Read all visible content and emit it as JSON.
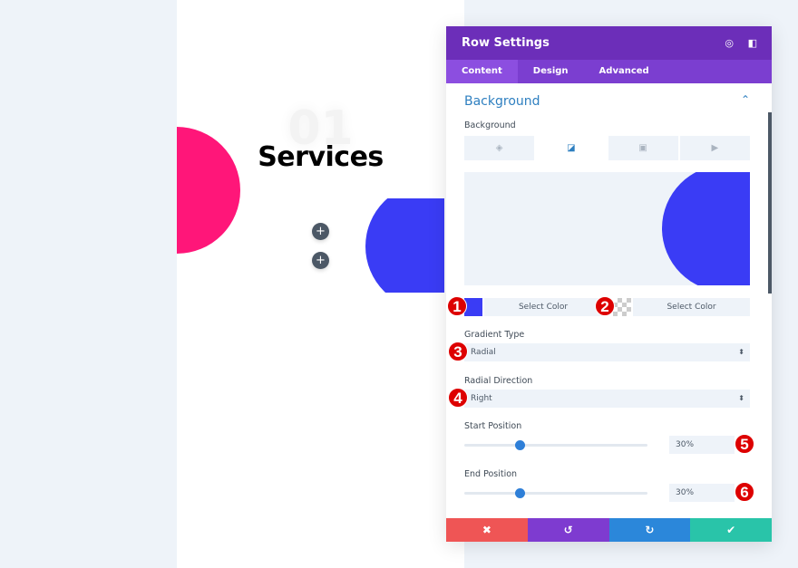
{
  "canvas": {
    "number": "01",
    "title": "Services",
    "add_buttons": [
      "+",
      "+"
    ],
    "colors": {
      "pink": "#ff1679",
      "blue": "#3a3cf5"
    }
  },
  "panel": {
    "title": "Row Settings",
    "header_icons": [
      "focus-icon",
      "sidebar-toggle-icon"
    ],
    "tabs": [
      {
        "label": "Content",
        "active": true
      },
      {
        "label": "Design"
      },
      {
        "label": "Advanced"
      }
    ],
    "section_title": "Background",
    "background_label": "Background",
    "background_types": [
      "color-icon",
      "gradient-icon",
      "image-icon",
      "video-icon"
    ],
    "active_background_type": "gradient",
    "gradient": {
      "color1": {
        "swatch": "#3a3cf5",
        "label": "Select Color",
        "badge": "1"
      },
      "color2": {
        "swatch": "transparent",
        "label": "Select Color",
        "badge": "2"
      },
      "gradient_type": {
        "label": "Gradient Type",
        "value": "Radial",
        "badge": "3"
      },
      "radial_direction": {
        "label": "Radial Direction",
        "value": "Right",
        "badge": "4"
      },
      "start_position": {
        "label": "Start Position",
        "value": "30%",
        "percent": 30,
        "badge": "5"
      },
      "end_position": {
        "label": "End Position",
        "value": "30%",
        "percent": 30,
        "badge": "6"
      }
    },
    "footer": {
      "cancel": "✖",
      "undo": "↺",
      "redo": "↻",
      "save": "✔",
      "colors": {
        "cancel": "#ef5555",
        "undo": "#7e3bd0",
        "redo": "#2b87da",
        "save": "#29c4a9"
      }
    }
  }
}
